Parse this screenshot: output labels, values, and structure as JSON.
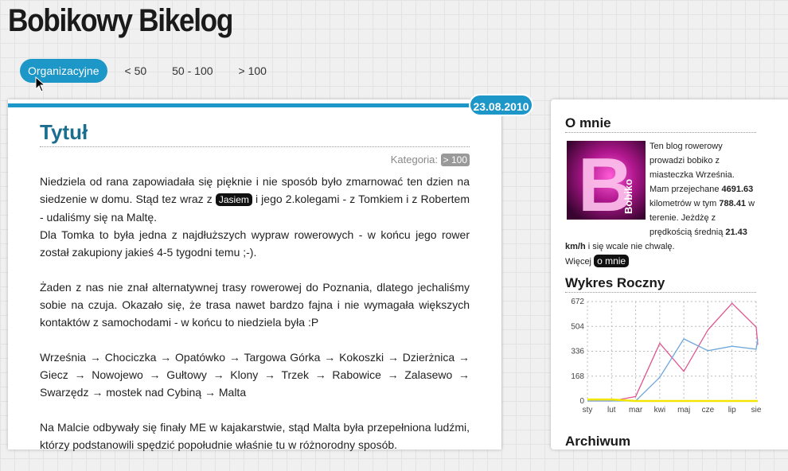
{
  "site": {
    "title": "Bobikowy Bikelog"
  },
  "nav": {
    "items": [
      {
        "label": "Organizacyjne",
        "active": true
      },
      {
        "label": "< 50"
      },
      {
        "label": "50 - 100"
      },
      {
        "label": "> 100"
      }
    ]
  },
  "post": {
    "date": "23.08.2010",
    "title": "Tytuł",
    "category_label": "Kategoria:",
    "category_value": "> 100",
    "p1_a": "Niedziela od rana zapowiadała się pięknie i nie sposób było zmarnować ten dzien na siedzenie w domu. Stąd tez wraz z ",
    "p1_tag": "Jasiem",
    "p1_b": " i jego 2.kolegami - z Tomkiem i z Robertem - udaliśmy się na Maltę.",
    "p2": "Dla Tomka to była jedna z najdłuższych wypraw rowerowych - w końcu jego rower został zakupiony jakieś 4-5 tygodni temu ;-).",
    "p3": "Żaden z nas nie znał alternatywnej trasy rowerowej do Poznania, dlatego jechaliśmy sobie na czuja. Okazało się, że trasa nawet bardzo fajna i nie wymagała większych kontaktów z samochodami - w końcu to niedziela była :P",
    "p4": "Września → Chociczka → Opatówko → Targowa Górka → Kokoszki → Dzierżnica → Giecz → Nowojewo → Gułtowy → Klony → Trzek → Rabowice → Zalasewo → Swarzędz → mostek nad Cybiną → Malta",
    "p5": "Na Malcie odbywały się finały ME w kajakarstwie, stąd Malta była przepełniona ludźmi, którzy podstanowili spędzić popołudnie właśnie tu w różnorodny sposób."
  },
  "sidebar": {
    "about": {
      "title": "O mnie",
      "avatar_text": "Bobiko",
      "t1": "Ten blog rowerowy prowadzi bobiko z miasteczka Września. Mam przejechane ",
      "km_total": "4691.63",
      "t2": " kilometrów w tym ",
      "km_terrain": "788.41",
      "t3": " w terenie. Jeżdżę z prędkością średnią ",
      "speed": "21.43 km/h",
      "t4": " i się wcale nie chwalę.",
      "more_label": "Więcej",
      "more_button": "o mnie"
    },
    "chart_title": "Wykres Roczny",
    "archive_title": "Archiwum"
  },
  "chart_data": {
    "type": "line",
    "categories": [
      "sty",
      "lut",
      "mar",
      "kwi",
      "maj",
      "cze",
      "lip",
      "sie"
    ],
    "y_ticks": [
      0,
      168,
      336,
      504,
      672
    ],
    "ylim": [
      0,
      672
    ],
    "grid": true,
    "series": [
      {
        "color": "#e0558f",
        "values": [
          0,
          0,
          30,
          390,
          200,
          480,
          660,
          500,
          380
        ]
      },
      {
        "color": "#6fa8dc",
        "values": [
          0,
          0,
          0,
          160,
          420,
          340,
          370,
          350,
          420
        ]
      },
      {
        "color": "#f2e600",
        "values": [
          10,
          10,
          0,
          0,
          0,
          0,
          0,
          0,
          0
        ]
      }
    ]
  }
}
